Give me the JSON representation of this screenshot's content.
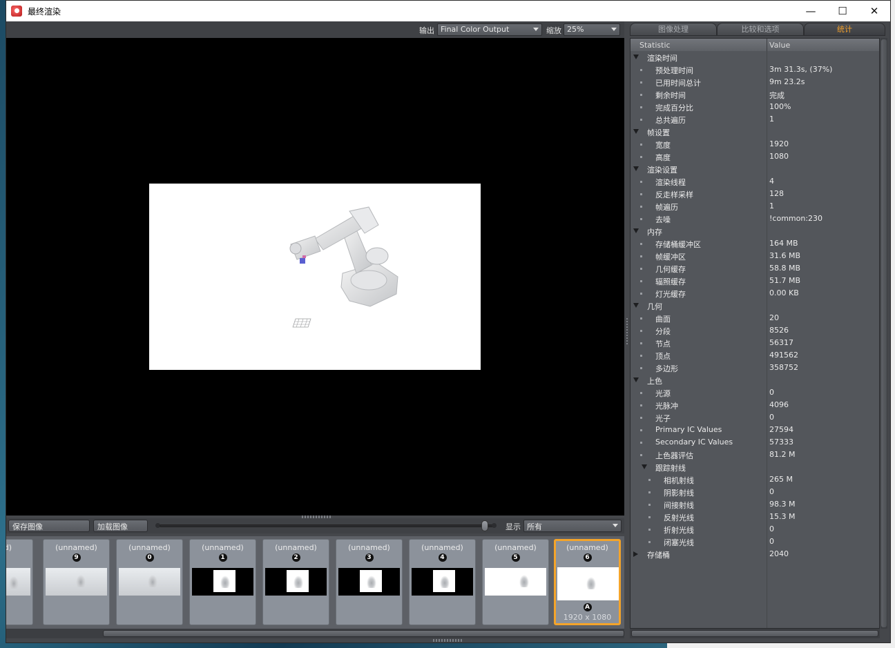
{
  "window": {
    "title": "最终渲染"
  },
  "toolbar": {
    "output_label": "输出",
    "output_value": "Final Color Output",
    "zoom_label": "缩放",
    "zoom_value": "25%"
  },
  "bottom": {
    "save_label": "保存图像",
    "load_label": "加载图像",
    "display_label": "显示",
    "display_value": "所有"
  },
  "thumbnails": [
    {
      "name": "ned)",
      "badge": "",
      "style": "light"
    },
    {
      "name": "(unnamed)",
      "badge": "9",
      "style": "light"
    },
    {
      "name": "(unnamed)",
      "badge": "0",
      "style": "light"
    },
    {
      "name": "(unnamed)",
      "badge": "1",
      "style": "dark"
    },
    {
      "name": "(unnamed)",
      "badge": "2",
      "style": "dark"
    },
    {
      "name": "(unnamed)",
      "badge": "3",
      "style": "dark"
    },
    {
      "name": "(unnamed)",
      "badge": "4",
      "style": "dark"
    },
    {
      "name": "(unnamed)",
      "badge": "5",
      "style": "white"
    },
    {
      "name": "(unnamed)",
      "badge": "6",
      "style": "white",
      "selected": true,
      "bottom_badge": "A",
      "dims": "1920 x 1080"
    }
  ],
  "panel": {
    "tabs": [
      "图像处理",
      "比较和选项",
      "统计"
    ],
    "active_tab": 2,
    "header_statistic": "Statistic",
    "header_value": "Value"
  },
  "stats": [
    {
      "level": 0,
      "name": "渲染时间",
      "value": "",
      "expandable": true,
      "expanded": true
    },
    {
      "level": 1,
      "name": "预处理时间",
      "value": "3m 31.3s, (37%)"
    },
    {
      "level": 1,
      "name": "已用时间总计",
      "value": "9m 23.2s"
    },
    {
      "level": 1,
      "name": "剩余时间",
      "value": "完成"
    },
    {
      "level": 1,
      "name": "完成百分比",
      "value": "100%"
    },
    {
      "level": 1,
      "name": "总共遍历",
      "value": "1"
    },
    {
      "level": 0,
      "name": "帧设置",
      "value": "",
      "expandable": true,
      "expanded": true
    },
    {
      "level": 1,
      "name": "宽度",
      "value": "1920"
    },
    {
      "level": 1,
      "name": "高度",
      "value": "1080"
    },
    {
      "level": 0,
      "name": "渲染设置",
      "value": "",
      "expandable": true,
      "expanded": true
    },
    {
      "level": 1,
      "name": "渲染线程",
      "value": "4"
    },
    {
      "level": 1,
      "name": "反走样采样",
      "value": "128"
    },
    {
      "level": 1,
      "name": "帧遍历",
      "value": "1"
    },
    {
      "level": 1,
      "name": "去噪",
      "value": "!common:230"
    },
    {
      "level": 0,
      "name": "内存",
      "value": "",
      "expandable": true,
      "expanded": true
    },
    {
      "level": 1,
      "name": "存储桶缓冲区",
      "value": "164 MB"
    },
    {
      "level": 1,
      "name": "帧缓冲区",
      "value": "31.6 MB"
    },
    {
      "level": 1,
      "name": "几何缓存",
      "value": "58.8 MB"
    },
    {
      "level": 1,
      "name": "辐照缓存",
      "value": "51.7 MB"
    },
    {
      "level": 1,
      "name": "灯光缓存",
      "value": "0.00 KB"
    },
    {
      "level": 0,
      "name": "几何",
      "value": "",
      "expandable": true,
      "expanded": true
    },
    {
      "level": 1,
      "name": "曲面",
      "value": "20"
    },
    {
      "level": 1,
      "name": "分段",
      "value": "8526"
    },
    {
      "level": 1,
      "name": "节点",
      "value": "56317"
    },
    {
      "level": 1,
      "name": "顶点",
      "value": "491562"
    },
    {
      "level": 1,
      "name": "多边形",
      "value": "358752"
    },
    {
      "level": 0,
      "name": "上色",
      "value": "",
      "expandable": true,
      "expanded": true
    },
    {
      "level": 1,
      "name": "光源",
      "value": "0"
    },
    {
      "level": 1,
      "name": "光脉冲",
      "value": "4096"
    },
    {
      "level": 1,
      "name": "光子",
      "value": "0"
    },
    {
      "level": 1,
      "name": "Primary IC Values",
      "value": "27594"
    },
    {
      "level": 1,
      "name": "Secondary IC Values",
      "value": "57333"
    },
    {
      "level": 1,
      "name": "上色器评估",
      "value": "81.2 M"
    },
    {
      "level": 1,
      "name": "跟踪射线",
      "value": "",
      "expandable": true,
      "expanded": true
    },
    {
      "level": 2,
      "name": "相机射线",
      "value": "265 M"
    },
    {
      "level": 2,
      "name": "阴影射线",
      "value": "0"
    },
    {
      "level": 2,
      "name": "间接射线",
      "value": "98.3 M"
    },
    {
      "level": 2,
      "name": "反射光线",
      "value": "15.3 M"
    },
    {
      "level": 2,
      "name": "折射光线",
      "value": "0"
    },
    {
      "level": 2,
      "name": "闭塞光线",
      "value": "0"
    },
    {
      "level": 0,
      "name": "存储桶",
      "value": "2040",
      "expandable": true,
      "expanded": false
    }
  ],
  "colors": {
    "accent": "#f4a42a",
    "panel_bg": "#53565b",
    "window_bg": "#45474b"
  }
}
